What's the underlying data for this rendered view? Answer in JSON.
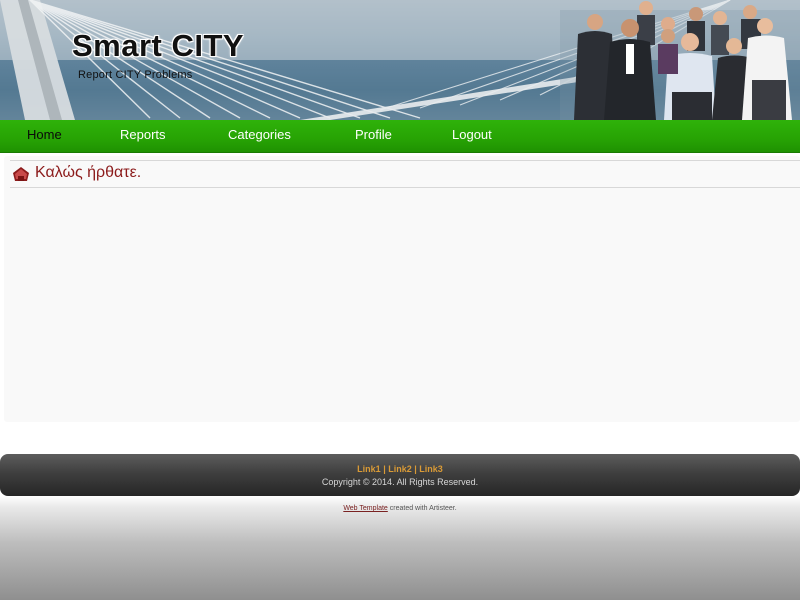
{
  "header": {
    "title": "Smart CITY",
    "slogan": "Report CITY Problems"
  },
  "nav": {
    "items": [
      {
        "label": "Home",
        "active": true
      },
      {
        "label": "Reports",
        "active": false
      },
      {
        "label": "Categories",
        "active": false
      },
      {
        "label": "Profile",
        "active": false
      },
      {
        "label": "Logout",
        "active": false
      }
    ]
  },
  "content": {
    "post_title": "Καλώς ήρθατε."
  },
  "footer": {
    "links": [
      "Link1",
      "Link2",
      "Link3"
    ],
    "separator": "|",
    "copyright": "Copyright © 2014. All Rights Reserved."
  },
  "credit": {
    "link_text": "Web Template",
    "text": "created with Artisteer."
  },
  "colors": {
    "nav_green": "#27a304",
    "title_red": "#8c1b1b",
    "footer_link": "#d99a36"
  }
}
